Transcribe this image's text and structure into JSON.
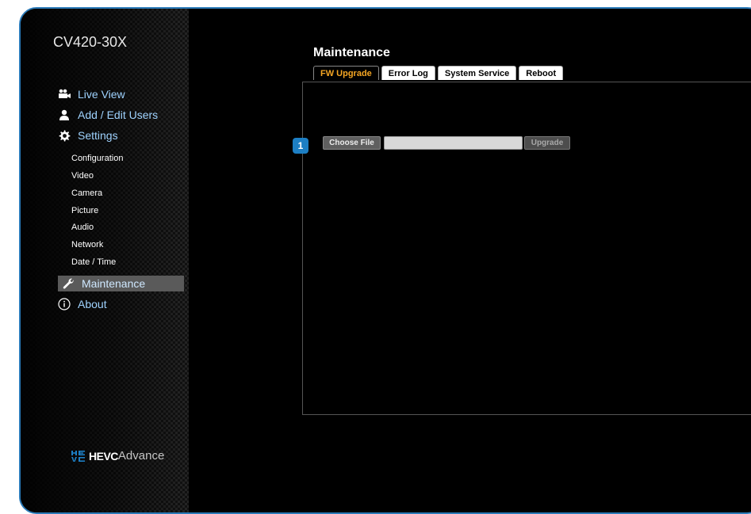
{
  "app": {
    "model": "CV420-30X"
  },
  "sidebar": {
    "nav": [
      {
        "label": "Live View",
        "icon": "camera-icon"
      },
      {
        "label": "Add / Edit Users",
        "icon": "user-icon"
      },
      {
        "label": "Settings",
        "icon": "gear-icon"
      }
    ],
    "settings_items": [
      "Configuration",
      "Video",
      "Camera",
      "Picture",
      "Audio",
      "Network",
      "Date / Time"
    ],
    "maintenance": {
      "label": "Maintenance",
      "icon": "wrench-icon"
    },
    "about": {
      "label": "About",
      "icon": "info-icon"
    },
    "logo": {
      "mark": "HEVC",
      "wordmark_bold": "HEVC",
      "wordmark_light": "Advance"
    }
  },
  "main": {
    "title": "Maintenance",
    "tabs": [
      {
        "label": "FW Upgrade",
        "active": true
      },
      {
        "label": "Error Log",
        "active": false
      },
      {
        "label": "System Service",
        "active": false
      },
      {
        "label": "Reboot",
        "active": false
      }
    ],
    "step_badge": "1",
    "choose_file_label": "Choose File",
    "file_value": "",
    "upgrade_label": "Upgrade"
  },
  "colors": {
    "accent_blue": "#1d7fc4",
    "active_tab_text": "#f5a623",
    "nav_text": "#9fd3ff"
  }
}
